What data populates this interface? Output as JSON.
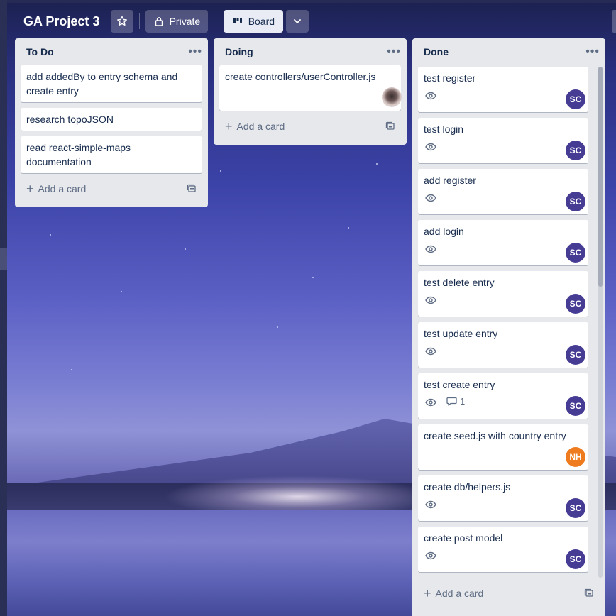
{
  "header": {
    "title": "GA Project 3",
    "star_icon": "star-icon",
    "visibility_label": "Private",
    "view_label": "Board"
  },
  "lists": [
    {
      "title": "To Do",
      "cards": [
        {
          "title": "add addedBy to entry schema and create entry"
        },
        {
          "title": "research topoJSON"
        },
        {
          "title": "read react-simple-maps documentation"
        }
      ],
      "add_label": "Add a card"
    },
    {
      "title": "Doing",
      "cards": [
        {
          "title": "create controllers/userController.js"
        }
      ],
      "add_label": "Add a card"
    },
    {
      "title": "Done",
      "cards": [
        {
          "title": "test register",
          "member": "SC"
        },
        {
          "title": "test login",
          "member": "SC"
        },
        {
          "title": "add register",
          "member": "SC"
        },
        {
          "title": "add login",
          "member": "SC"
        },
        {
          "title": "test delete entry",
          "member": "SC"
        },
        {
          "title": "test update entry",
          "member": "SC"
        },
        {
          "title": "test create entry",
          "member": "SC",
          "comments": "1"
        },
        {
          "title": "create seed.js with country entry",
          "member": "NH"
        },
        {
          "title": "create db/helpers.js",
          "member": "SC"
        },
        {
          "title": "create post model",
          "member": "SC"
        }
      ],
      "add_label": "Add a card"
    }
  ],
  "colors": {
    "avatar_sc": "#463c94",
    "avatar_nh": "#ee7b1d",
    "list_bg": "#e7e8ec"
  }
}
